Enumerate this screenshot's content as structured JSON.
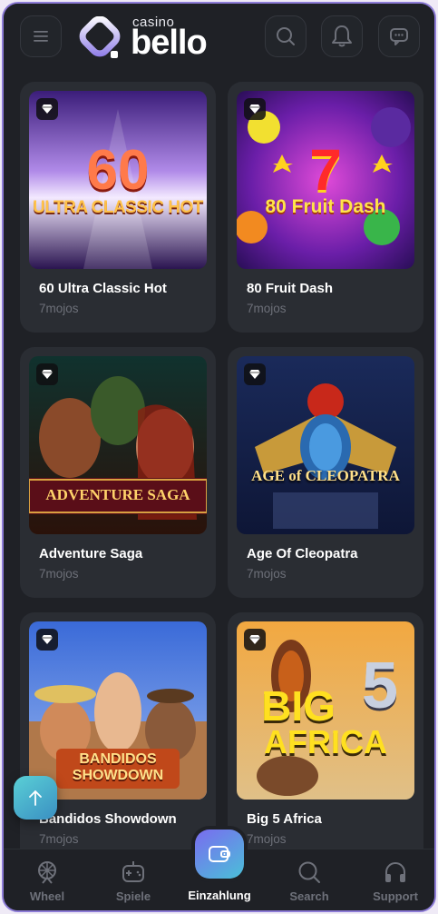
{
  "header": {
    "logo_small": "casino",
    "logo_big": "bello",
    "menu_icon": "hamburger-icon",
    "search_icon": "search-icon",
    "bell_icon": "bell-icon",
    "chat_icon": "chat-icon"
  },
  "games": [
    {
      "title": "60 Ultra Classic Hot",
      "provider": "7mojos",
      "art_line1": "60",
      "art_line2": "ULTRA CLASSIC HOT"
    },
    {
      "title": "80 Fruit Dash",
      "provider": "7mojos",
      "art_line1": "7",
      "art_line2": "80 Fruit Dash"
    },
    {
      "title": "Adventure Saga",
      "provider": "7mojos",
      "art_line1": "ADVENTURE SAGA"
    },
    {
      "title": "Age Of Cleopatra",
      "provider": "7mojos",
      "art_line1": "AGE of CLEOPATRA"
    },
    {
      "title": "Bandidos Showdown",
      "provider": "7mojos",
      "art_line1": "BANDIDOS",
      "art_line2": "SHOWDOWN"
    },
    {
      "title": "Big 5 Africa",
      "provider": "7mojos",
      "art_line1": "BIG",
      "art_line2": "AFRICA",
      "art_num": "5"
    }
  ],
  "nav": {
    "wheel": "Wheel",
    "games": "Spiele",
    "deposit": "Einzahlung",
    "search": "Search",
    "support": "Support"
  },
  "colors": {
    "accent_start": "#7a6bf0",
    "accent_end": "#4ac0d8",
    "background": "#1f2126",
    "card": "#2a2d33"
  }
}
